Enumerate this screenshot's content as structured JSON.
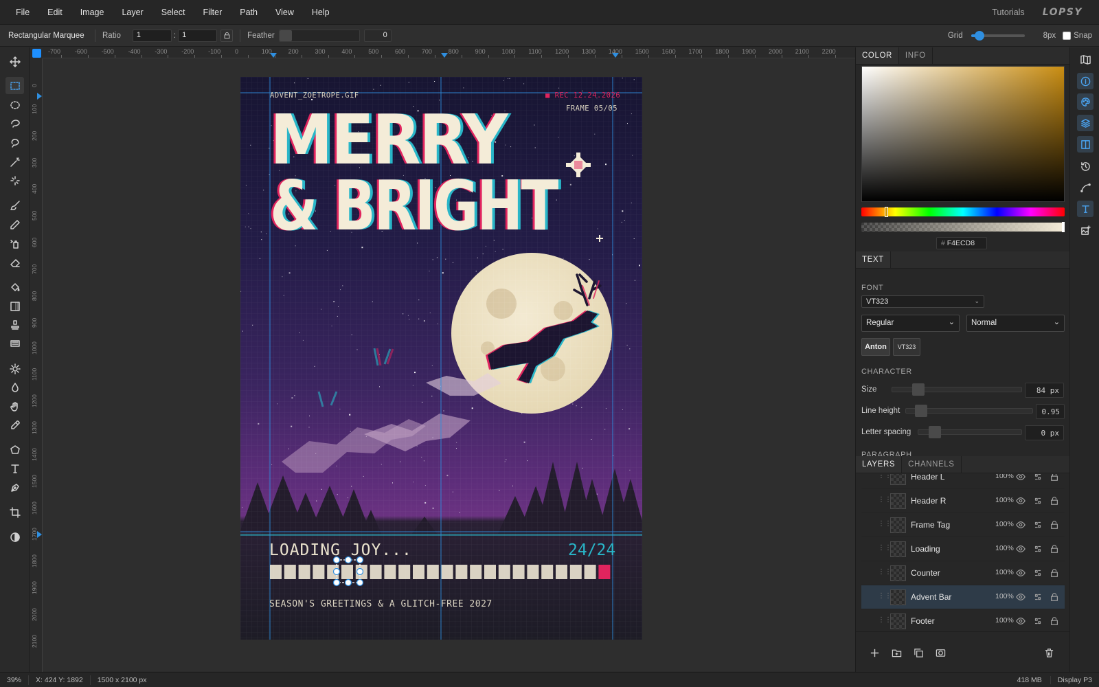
{
  "menu": [
    "File",
    "Edit",
    "Image",
    "Layer",
    "Select",
    "Filter",
    "Path",
    "View",
    "Help"
  ],
  "header": {
    "tutorials": "Tutorials",
    "logo": "LOPSY"
  },
  "options": {
    "tool": "Rectangular Marquee",
    "ratio_label": "Ratio",
    "ratio_w": "1",
    "ratio_sep": ":",
    "ratio_h": "1",
    "feather_label": "Feather",
    "feather_value": "0",
    "grid_label": "Grid",
    "grid_value": "8px",
    "snap_label": "Snap"
  },
  "ruler_top": [
    "-700",
    "-600",
    "-500",
    "-400",
    "-300",
    "-200",
    "-100",
    "0",
    "100",
    "200",
    "300",
    "400",
    "500",
    "600",
    "700",
    "800",
    "900",
    "1000",
    "1100",
    "1200",
    "1300",
    "1400",
    "1500",
    "1600",
    "1700",
    "1800",
    "1900",
    "2000",
    "2100",
    "2200"
  ],
  "ruler_left": [
    "0",
    "100",
    "200",
    "300",
    "400",
    "500",
    "600",
    "700",
    "800",
    "900",
    "1000",
    "1100",
    "1200",
    "1300",
    "1400",
    "1500",
    "1600",
    "1700",
    "1800",
    "1900",
    "2000",
    "2100"
  ],
  "poster": {
    "file_tag": "ADVENT_ZOETROPE.GIF",
    "rec_tag": "■ REC 12.24.2026",
    "frame_tag": "FRAME 05/05",
    "title_line1": "MERRY",
    "title_line2": "& BRIGHT",
    "loading": "LOADING JOY...",
    "counter": "24/24",
    "footer": "SEASON'S GREETINGS & A GLITCH-FREE 2027"
  },
  "color_panel": {
    "tabs": [
      "COLOR",
      "INFO"
    ],
    "hex_prefix": "#",
    "hex": "F4ECD8"
  },
  "text_panel": {
    "tab": "TEXT",
    "font_label": "FONT",
    "font_value": "VT323",
    "style_value": "Regular",
    "weight_value": "Normal",
    "quick_fonts": [
      "Anton",
      "VT323"
    ],
    "character_label": "CHARACTER",
    "size_label": "Size",
    "size_value": "84 px",
    "line_height_label": "Line height",
    "line_height_value": "0.95",
    "letter_spacing_label": "Letter spacing",
    "letter_spacing_value": "0 px",
    "paragraph_label": "PARAGRAPH"
  },
  "layers_panel": {
    "tabs": [
      "LAYERS",
      "CHANNELS"
    ],
    "layers": [
      {
        "name": "Header L",
        "opacity": "100%"
      },
      {
        "name": "Header R",
        "opacity": "100%"
      },
      {
        "name": "Frame Tag",
        "opacity": "100%"
      },
      {
        "name": "Loading",
        "opacity": "100%"
      },
      {
        "name": "Counter",
        "opacity": "100%"
      },
      {
        "name": "Advent Bar",
        "opacity": "100%"
      },
      {
        "name": "Footer",
        "opacity": "100%"
      }
    ],
    "selected": "Advent Bar"
  },
  "status": {
    "zoom": "39%",
    "coords": "X: 424  Y: 1892",
    "doc_size": "1500 x 2100 px",
    "memory": "418 MB",
    "profile": "Display P3"
  },
  "colors": {
    "accent": "#2f8fe0",
    "poster_cream": "#F4ECD8",
    "glitch_red": "#e0245e",
    "glitch_cyan": "#29b6c8"
  },
  "progress": {
    "filled_segments": 24,
    "total_segments": 24
  }
}
